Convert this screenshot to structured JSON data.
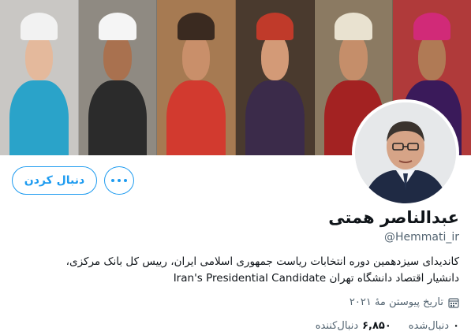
{
  "banner": {
    "panels": [
      {
        "name": "panel-woman-white-veil",
        "bg": "#c9c7c4",
        "face": "#e4b99c",
        "hat": "#f2f2f2",
        "body": "#2aa3c9"
      },
      {
        "name": "panel-man-white-turban",
        "bg": "#8f8a82",
        "face": "#a9714f",
        "hat": "#f5f5f5",
        "body": "#2b2b2b"
      },
      {
        "name": "panel-girl-red-dress",
        "bg": "#a67a52",
        "face": "#c98f6a",
        "hat": "#3a2a20",
        "body": "#d23a2f"
      },
      {
        "name": "panel-woman-patterned-scarf",
        "bg": "#4a3a2e",
        "face": "#d39a77",
        "hat": "#c03a2a",
        "body": "#3b2b4a"
      },
      {
        "name": "panel-man-fur-hat",
        "bg": "#8b7a62",
        "face": "#c58e6a",
        "hat": "#e9e2d0",
        "body": "#a32222"
      },
      {
        "name": "panel-woman-mask",
        "bg": "#b03a3a",
        "face": "#b07a55",
        "hat": "#d12a78",
        "body": "#3a1a5a"
      }
    ]
  },
  "profile": {
    "name": "عبدالناصر همتی",
    "handle": "@Hemmati_ir",
    "bio_line1": "کاندیدای سیزدهمین دوره انتخابات ریاست جمهوری اسلامی ایران، رییس کل بانک مرکزی،",
    "bio_line2": "دانشیار اقتصاد دانشگاه تهران Iran's Presidential Candidate",
    "joined": "تاریخ پیوستن مهٔ ۲۰۲۱",
    "following_count": "۰",
    "following_label": "دنبال‌شده",
    "followers_count": "۶,۸۵۰",
    "followers_label": "دنبال‌کننده"
  },
  "actions": {
    "follow_label": "دنبال کردن",
    "more_icon": "more-horizontal-icon"
  },
  "colors": {
    "accent": "#1d9bf0",
    "secondary_text": "#536471",
    "primary_text": "#0f1419"
  }
}
